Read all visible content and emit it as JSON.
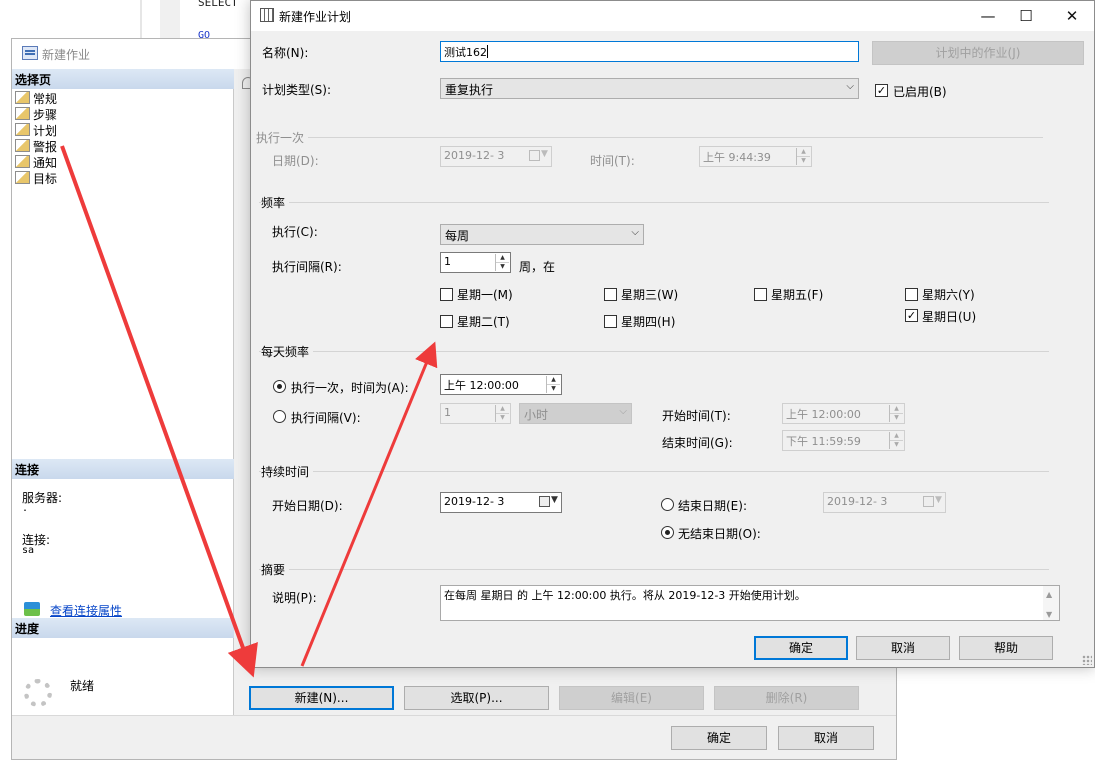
{
  "editor": {
    "sql_text": "SELECT",
    "go_text": "GO"
  },
  "job_dialog": {
    "title": "新建作业",
    "select_page_header": "选择页",
    "pages": [
      "常规",
      "步骤",
      "计划",
      "警报",
      "通知",
      "目标"
    ],
    "connection_header": "连接",
    "server_label": "服务器:",
    "server_value": ".",
    "connection_label": "连接:",
    "connection_value": "sa",
    "view_connection_link": "查看连接属性",
    "progress_header": "进度",
    "progress_status": "就绪",
    "buttons": {
      "new": "新建(N)...",
      "pick": "选取(P)...",
      "edit": "编辑(E)",
      "delete": "删除(R)",
      "ok": "确定",
      "cancel": "取消"
    }
  },
  "schedule_dialog": {
    "title": "新建作业计划",
    "controls": {
      "minimize": "—",
      "maximize": "☐",
      "close": "✕"
    },
    "name_label": "名称(N):",
    "name_value": "测试162",
    "jobs_in_schedule_button": "计划中的作业(J)",
    "schedule_type_label": "计划类型(S):",
    "schedule_type_value": "重复执行",
    "enabled_label": "已启用(B)",
    "enabled_checked": true,
    "once_section": {
      "title": "执行一次",
      "date_label": "日期(D):",
      "date_value": "2019-12- 3",
      "time_label": "时间(T):",
      "time_value": "上午  9:44:39"
    },
    "frequency_section": {
      "title": "频率",
      "occurs_label": "执行(C):",
      "occurs_value": "每周",
      "recurs_label": "执行间隔(R):",
      "recurs_value": "1",
      "recurs_suffix": "周，在",
      "days": [
        {
          "label": "星期一(M)",
          "checked": false
        },
        {
          "label": "星期三(W)",
          "checked": false
        },
        {
          "label": "星期五(F)",
          "checked": false
        },
        {
          "label": "星期六(Y)",
          "checked": false
        },
        {
          "label": "星期二(T)",
          "checked": false
        },
        {
          "label": "星期四(H)",
          "checked": false
        },
        {
          "label": "星期日(U)",
          "checked": true
        }
      ]
    },
    "daily_section": {
      "title": "每天频率",
      "once_at_label": "执行一次，时间为(A):",
      "once_at_value": "上午 12:00:00",
      "once_at_selected": true,
      "every_label": "执行间隔(V):",
      "every_value": "1",
      "every_unit": "小时",
      "start_time_label": "开始时间(T):",
      "start_time_value": "上午 12:00:00",
      "end_time_label": "结束时间(G):",
      "end_time_value": "下午 11:59:59"
    },
    "duration_section": {
      "title": "持续时间",
      "start_date_label": "开始日期(D):",
      "start_date_value": "2019-12- 3",
      "end_date_label": "结束日期(E):",
      "end_date_value": "2019-12- 3",
      "no_end_label": "无结束日期(O):",
      "no_end_selected": true
    },
    "summary_section": {
      "title": "摘要",
      "description_label": "说明(P):",
      "description_value": "在每周 星期日 的 上午 12:00:00 执行。将从 2019-12-3 开始使用计划。"
    },
    "buttons": {
      "ok": "确定",
      "cancel": "取消",
      "help": "帮助"
    }
  },
  "colors": {
    "annotation_arrow": "#ee3b3b",
    "accent": "#0078d7"
  }
}
